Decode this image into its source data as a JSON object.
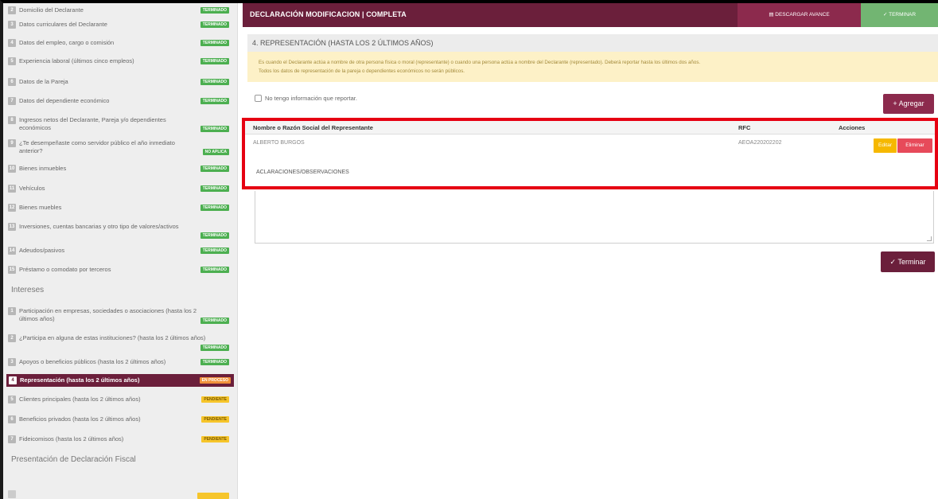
{
  "sidebar": {
    "items": [
      {
        "num": "2",
        "label": "Domicilio del Declarante",
        "status": "TERMINADO",
        "kind": "ok"
      },
      {
        "num": "3",
        "label": "Datos curriculares del Declarante",
        "status": "TERMINADO",
        "kind": "ok"
      },
      {
        "num": "4",
        "label": "Datos del empleo, cargo o comisión",
        "status": "TERMINADO",
        "kind": "ok"
      },
      {
        "num": "5",
        "label": "Experiencia laboral (últimos cinco empleos)",
        "status": "TERMINADO",
        "kind": "ok"
      },
      {
        "num": "6",
        "label": "Datos de la Pareja",
        "status": "TERMINADO",
        "kind": "ok"
      },
      {
        "num": "7",
        "label": "Datos del dependiente económico",
        "status": "TERMINADO",
        "kind": "ok"
      },
      {
        "num": "8",
        "label": "Ingresos netos del Declarante, Pareja y/o dependientes económicos",
        "status": "TERMINADO",
        "kind": "ok"
      },
      {
        "num": "9",
        "label": "¿Te desempeñaste como servidor público el año inmediato anterior?",
        "status": "NO APLICA",
        "kind": "ok"
      },
      {
        "num": "10",
        "label": "Bienes inmuebles",
        "status": "TERMINADO",
        "kind": "ok"
      },
      {
        "num": "11",
        "label": "Vehículos",
        "status": "TERMINADO",
        "kind": "ok"
      },
      {
        "num": "12",
        "label": "Bienes muebles",
        "status": "TERMINADO",
        "kind": "ok"
      },
      {
        "num": "13",
        "label": "Inversiones, cuentas bancarias y otro tipo de valores/activos",
        "status": "TERMINADO",
        "kind": "ok"
      },
      {
        "num": "14",
        "label": "Adeudos/pasivos",
        "status": "TERMINADO",
        "kind": "ok"
      },
      {
        "num": "15",
        "label": "Préstamo o comodato por terceros",
        "status": "TERMINADO",
        "kind": "ok"
      }
    ],
    "section_intereses": "Intereses",
    "intereses_items": [
      {
        "num": "1",
        "label": "Participación en empresas, sociedades o asociaciones (hasta los 2 últimos años)",
        "status": "TERMINADO",
        "kind": "ok"
      },
      {
        "num": "2",
        "label": "¿Participa en alguna de estas instituciones? (hasta los 2 últimos años)",
        "status": "TERMINADO",
        "kind": "ok"
      },
      {
        "num": "3",
        "label": "Apoyos o beneficios públicos (hasta los 2 últimos años)",
        "status": "TERMINADO",
        "kind": "ok"
      },
      {
        "num": "4",
        "label": "Representación (hasta los 2 últimos años)",
        "status": "EN PROCESO",
        "kind": "active"
      },
      {
        "num": "5",
        "label": "Clientes principales (hasta los 2 últimos años)",
        "status": "PENDIENTE",
        "kind": "pend"
      },
      {
        "num": "6",
        "label": "Beneficios privados (hasta los 2 últimos años)",
        "status": "PENDIENTE",
        "kind": "pend"
      },
      {
        "num": "7",
        "label": "Fideicomisos (hasta los 2 últimos años)",
        "status": "PENDIENTE",
        "kind": "pend"
      }
    ],
    "section_fiscal": "Presentación de Declaración Fiscal"
  },
  "topbar": {
    "title": "DECLARACIÓN MODIFICACION | COMPLETA",
    "download_label": "DESCARGAR AVANCE",
    "finish_label": "TERMINAR"
  },
  "section": {
    "title": "4. REPRESENTACIÓN (HASTA LOS 2 ÚLTIMOS AÑOS)",
    "alert_line1": "Es cuando el Declarante actúa a nombre de otra persona física o moral (representante) o cuando una persona actúa a nombre del Declarante (representado). Deberá reportar hasta los últimos dos años.",
    "alert_line2": "Todos los datos de representación de la pareja o dependientes económicos no serán públicos."
  },
  "no_info_label": "No tengo información que reportar.",
  "add_label": "+ Agregar",
  "table": {
    "headers": [
      "Nombre o Razón Social del Representante",
      "RFC",
      "Acciones"
    ],
    "rows": [
      {
        "name": "ALBERTO BURGOS",
        "rfc": "AEOA220202202",
        "edit": "Editar",
        "delete": "Eliminar"
      }
    ]
  },
  "aclaraciones_label": "ACLARACIONES/OBSERVACIONES",
  "finish_button": "Terminar"
}
